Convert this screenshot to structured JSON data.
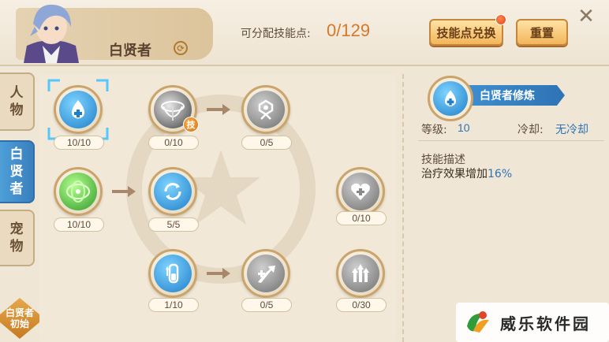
{
  "header": {
    "class_name": "白贤者",
    "points_label": "可分配技能点:",
    "points_value": "0/129",
    "exchange_button": "技能点兑换",
    "reset_button": "重置"
  },
  "nav": {
    "character": [
      "人",
      "物"
    ],
    "class_tab": [
      "白",
      "贤",
      "者"
    ],
    "pet": [
      "宠",
      "物"
    ],
    "bottom_label": "白贤者",
    "bottom_sub": "初始"
  },
  "skills": [
    {
      "label": "10/10",
      "icon": "healing-drop-icon"
    },
    {
      "label": "0/10",
      "icon": "vortex-icon",
      "badge": "技"
    },
    {
      "label": "0/5",
      "icon": "guardian-icon"
    },
    {
      "label": "10/10",
      "icon": "green-aura-icon"
    },
    {
      "label": "5/5",
      "icon": "cycle-icon"
    },
    {
      "label": "0/10",
      "icon": "heart-plus-icon"
    },
    {
      "label": "1/10",
      "icon": "vial-icon"
    },
    {
      "label": "0/5",
      "icon": "heal-boost-icon"
    },
    {
      "label": "0/30",
      "icon": "triple-arrow-icon"
    }
  ],
  "detail": {
    "skill_name": "白贤者修炼",
    "level_label": "等级:",
    "level_value": "10",
    "cooldown_label": "冷却:",
    "cooldown_value": "无冷却",
    "desc_title": "技能描述",
    "desc_text": "治疗效果增加",
    "desc_value": "16%"
  },
  "site": {
    "name": "威乐软件园"
  },
  "colors": {
    "accent_blue": "#2f73b4",
    "points_orange": "#d8772a",
    "button_gold": "#f2b65c"
  }
}
